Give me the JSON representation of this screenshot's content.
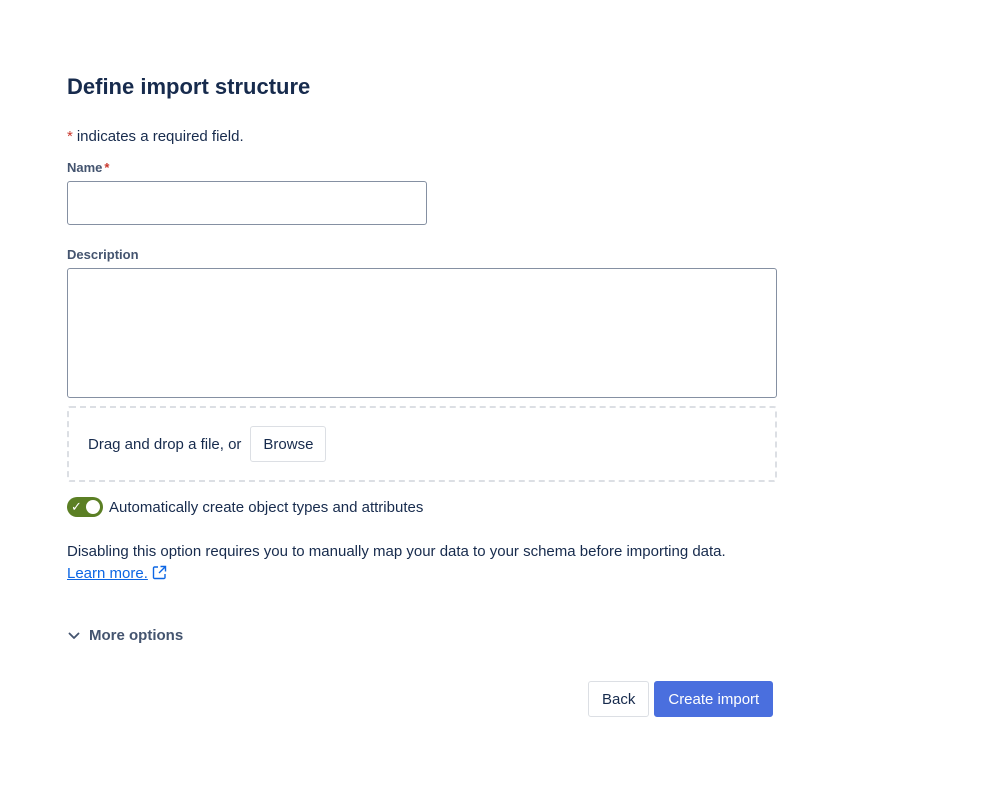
{
  "page": {
    "title": "Define import structure",
    "required_asterisk": "*",
    "required_note": "indicates a required field."
  },
  "fields": {
    "name": {
      "label": "Name",
      "required_mark": "*",
      "value": "",
      "placeholder": ""
    },
    "description": {
      "label": "Description",
      "value": "",
      "placeholder": ""
    }
  },
  "dropzone": {
    "text": "Drag and drop a file, or",
    "browse_label": "Browse"
  },
  "auto_create": {
    "checked": true,
    "check_glyph": "✓",
    "label": "Automatically create object types and attributes",
    "color": "#5b7f24"
  },
  "help": {
    "text": "Disabling this option requires you to manually map your data to your schema before importing data.",
    "link_label": "Learn more."
  },
  "more_options": {
    "label": "More options"
  },
  "footer": {
    "back_label": "Back",
    "create_label": "Create import"
  },
  "colors": {
    "primary": "#4a6fde",
    "required": "#c9372c",
    "link": "#0c66e4"
  }
}
